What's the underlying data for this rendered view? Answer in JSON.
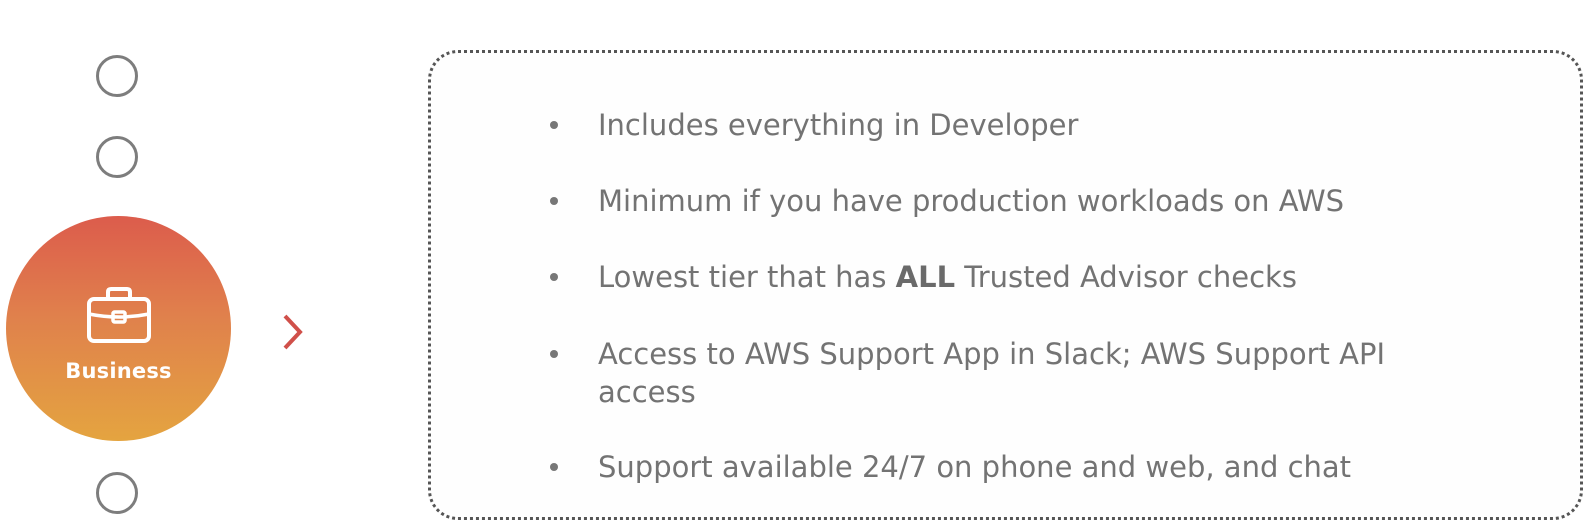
{
  "tier": {
    "label": "Business",
    "icon": "briefcase-icon",
    "gradient_top": "#dc5c4c",
    "gradient_bottom": "#e4a440"
  },
  "steps": [
    {
      "state": "inactive"
    },
    {
      "state": "inactive"
    },
    {
      "state": "active"
    },
    {
      "state": "inactive"
    }
  ],
  "accent_color": "#d0504a",
  "bullets": [
    {
      "text": "Includes everything in Developer"
    },
    {
      "text": "Minimum if you have production workloads on AWS"
    },
    {
      "text_before": "Lowest tier that has ",
      "text_bold": "ALL",
      "text_after": " Trusted Advisor checks"
    },
    {
      "line1": "Access to AWS Support App in Slack; AWS Support API",
      "line2": "access"
    },
    {
      "text": "Support available 24/7 on phone and web, and chat"
    }
  ]
}
